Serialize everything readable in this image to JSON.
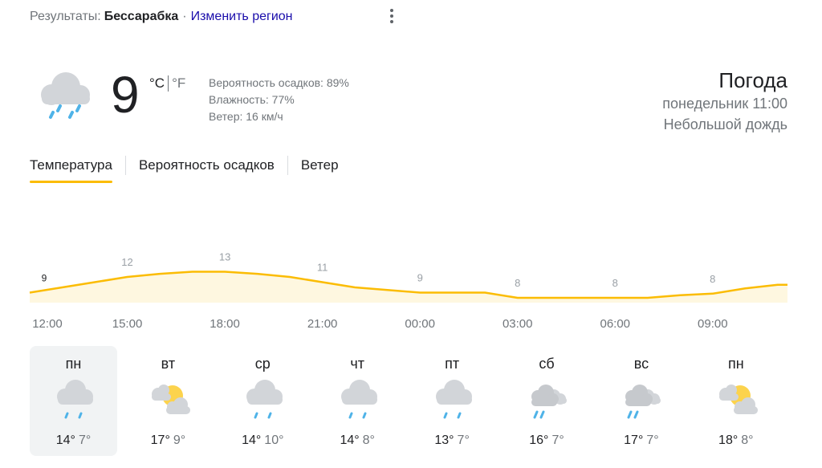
{
  "header": {
    "results_label": "Результаты:",
    "region": "Бессарабка",
    "separator": "·",
    "change_region": "Изменить регион"
  },
  "current": {
    "icon": "cloud-rain-icon",
    "temperature": "9",
    "unit_c": "°C",
    "unit_f": "°F",
    "precipitation": "Вероятность осадков: 89%",
    "humidity": "Влажность: 77%",
    "wind": "Ветер: 16 км/ч"
  },
  "summary": {
    "title": "Погода",
    "time": "понедельник 11:00",
    "condition": "Небольшой дождь"
  },
  "tabs": [
    {
      "label": "Температура",
      "active": true
    },
    {
      "label": "Вероятность осадков",
      "active": false
    },
    {
      "label": "Ветер",
      "active": false
    }
  ],
  "colors": {
    "accent": "#fbbc04",
    "chart_fill": "#fef7e0",
    "link": "#1a0dab"
  },
  "chart_data": {
    "type": "area",
    "x": [
      "12:00",
      "13:00",
      "14:00",
      "15:00",
      "16:00",
      "17:00",
      "18:00",
      "19:00",
      "20:00",
      "21:00",
      "22:00",
      "23:00",
      "00:00",
      "01:00",
      "02:00",
      "03:00",
      "04:00",
      "05:00",
      "06:00",
      "07:00",
      "08:00",
      "09:00",
      "10:00",
      "11:00"
    ],
    "values": [
      9,
      10,
      11,
      12,
      12.6,
      13,
      13,
      12.6,
      12,
      11,
      10,
      9.5,
      9,
      9,
      9,
      8,
      8,
      8,
      8,
      8,
      8.5,
      8.8,
      9.8,
      10.5
    ],
    "data_labels": [
      {
        "x": "12:00",
        "label": "9"
      },
      {
        "x": "15:00",
        "label": "12"
      },
      {
        "x": "18:00",
        "label": "13"
      },
      {
        "x": "21:00",
        "label": "11"
      },
      {
        "x": "00:00",
        "label": "9"
      },
      {
        "x": "03:00",
        "label": "8"
      },
      {
        "x": "06:00",
        "label": "8"
      },
      {
        "x": "09:00",
        "label": "8"
      }
    ],
    "tick_labels": [
      "12:00",
      "15:00",
      "18:00",
      "21:00",
      "00:00",
      "03:00",
      "06:00",
      "09:00"
    ],
    "ylim": [
      0,
      14
    ],
    "grid": false
  },
  "days": [
    {
      "name": "пн",
      "icon": "cloud-rain-icon",
      "hi": "14°",
      "lo": "7°",
      "selected": true
    },
    {
      "name": "вт",
      "icon": "sun-cloud-icon",
      "hi": "17°",
      "lo": "9°",
      "selected": false
    },
    {
      "name": "ср",
      "icon": "cloud-rain-icon",
      "hi": "14°",
      "lo": "10°",
      "selected": false
    },
    {
      "name": "чт",
      "icon": "cloud-rain-icon",
      "hi": "14°",
      "lo": "8°",
      "selected": false
    },
    {
      "name": "пт",
      "icon": "cloud-rain-icon",
      "hi": "13°",
      "lo": "7°",
      "selected": false
    },
    {
      "name": "сб",
      "icon": "clouds-rain-icon",
      "hi": "16°",
      "lo": "7°",
      "selected": false
    },
    {
      "name": "вс",
      "icon": "clouds-rain-icon",
      "hi": "17°",
      "lo": "7°",
      "selected": false
    },
    {
      "name": "пн",
      "icon": "sun-cloud-icon",
      "hi": "18°",
      "lo": "8°",
      "selected": false
    }
  ]
}
